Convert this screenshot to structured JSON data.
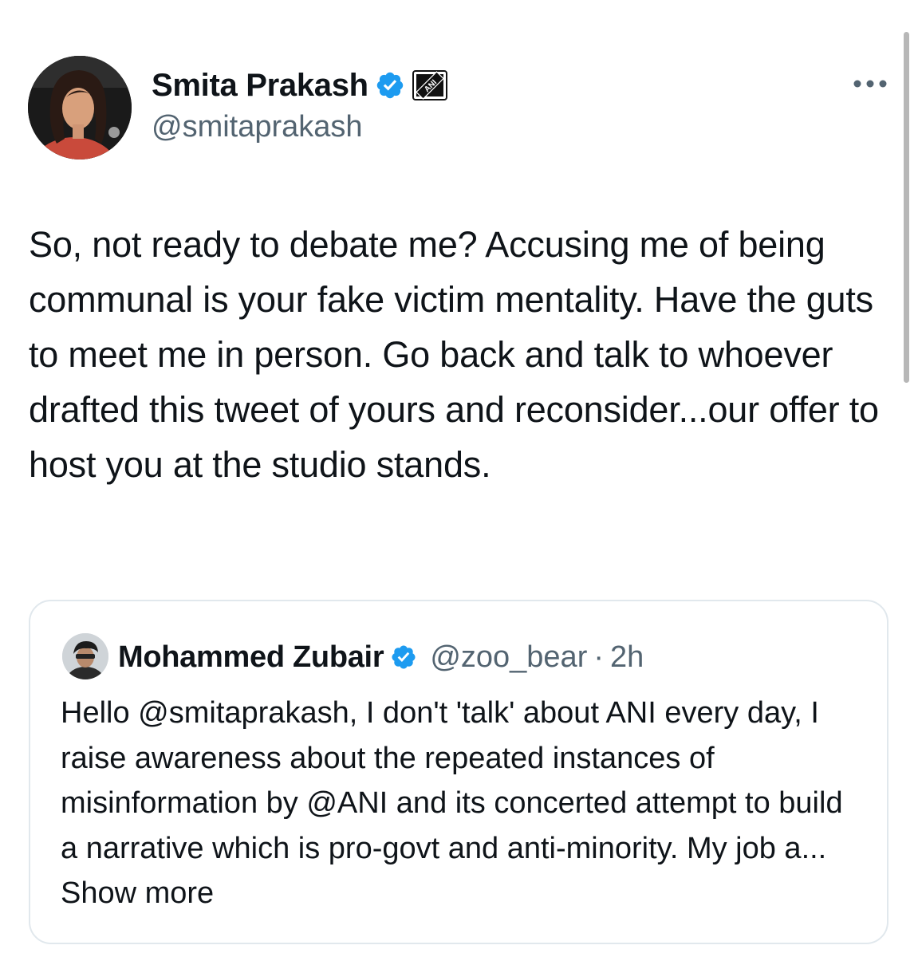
{
  "author": {
    "display_name": "Smita Prakash",
    "handle": "@smitaprakash",
    "verified": true,
    "affiliation_badge": "ANI"
  },
  "tweet": {
    "text": "So, not ready to debate me? Accusing me of being communal is your fake victim mentality. Have the guts to meet me in person. Go back and talk to whoever drafted this tweet of yours and reconsider...our offer to host you at the studio stands."
  },
  "quoted_tweet": {
    "display_name": "Mohammed Zubair",
    "handle": "@zoo_bear",
    "separator": "·",
    "time": "2h",
    "text": "Hello @smitaprakash, I don't 'talk' about ANI every day, I raise awareness about the repeated instances of misinformation by @ANI and its concerted attempt to build a narrative which is pro-govt and anti-minority. My job a...",
    "show_more_label": "Show more"
  },
  "colors": {
    "text_primary": "#0f1419",
    "text_secondary": "#536471",
    "verified_blue": "#1d9bf0",
    "card_border": "#e1e8ed",
    "scrollbar": "#b7b7b7"
  },
  "icons": {
    "verified": "verified-badge-icon",
    "affiliation": "ani-logo-icon",
    "more": "more-options-icon"
  }
}
